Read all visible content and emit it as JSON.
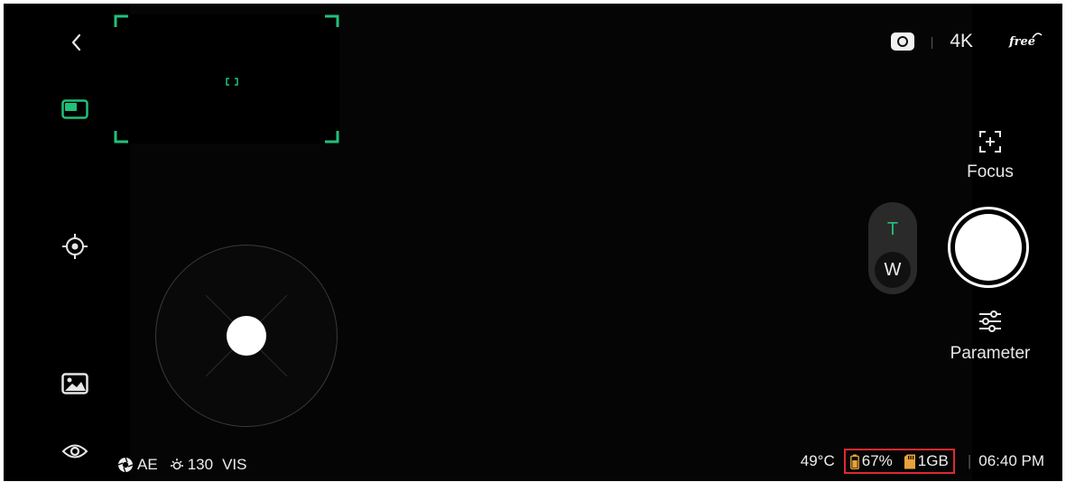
{
  "colors": {
    "accent": "#22c07a",
    "highlight_box": "#e0292e",
    "background": "#050505"
  },
  "left_bar": {
    "items": [
      {
        "icon": "back-icon"
      },
      {
        "icon": "pip-view-icon"
      },
      {
        "icon": "target-icon"
      },
      {
        "icon": "gallery-icon"
      },
      {
        "icon": "eye-icon"
      }
    ]
  },
  "top_right": {
    "mode_icon": "record-mode-icon",
    "separator": "|",
    "resolution": "4K",
    "brand_logo": "free"
  },
  "focus": {
    "icon": "focus-icon",
    "label": "Focus"
  },
  "parameter": {
    "icon": "sliders-icon",
    "label": "Parameter"
  },
  "zoom": {
    "tele": "T",
    "wide": "W",
    "selected": "W"
  },
  "joystick": {
    "arrows": [
      "up",
      "down",
      "left",
      "right"
    ]
  },
  "status": {
    "exposure_mode": "AE",
    "brightness": "130",
    "spectrum": "VIS",
    "temperature": "49°C",
    "battery": "67%",
    "storage": "1GB",
    "separator": "|",
    "time": "06:40 PM"
  }
}
